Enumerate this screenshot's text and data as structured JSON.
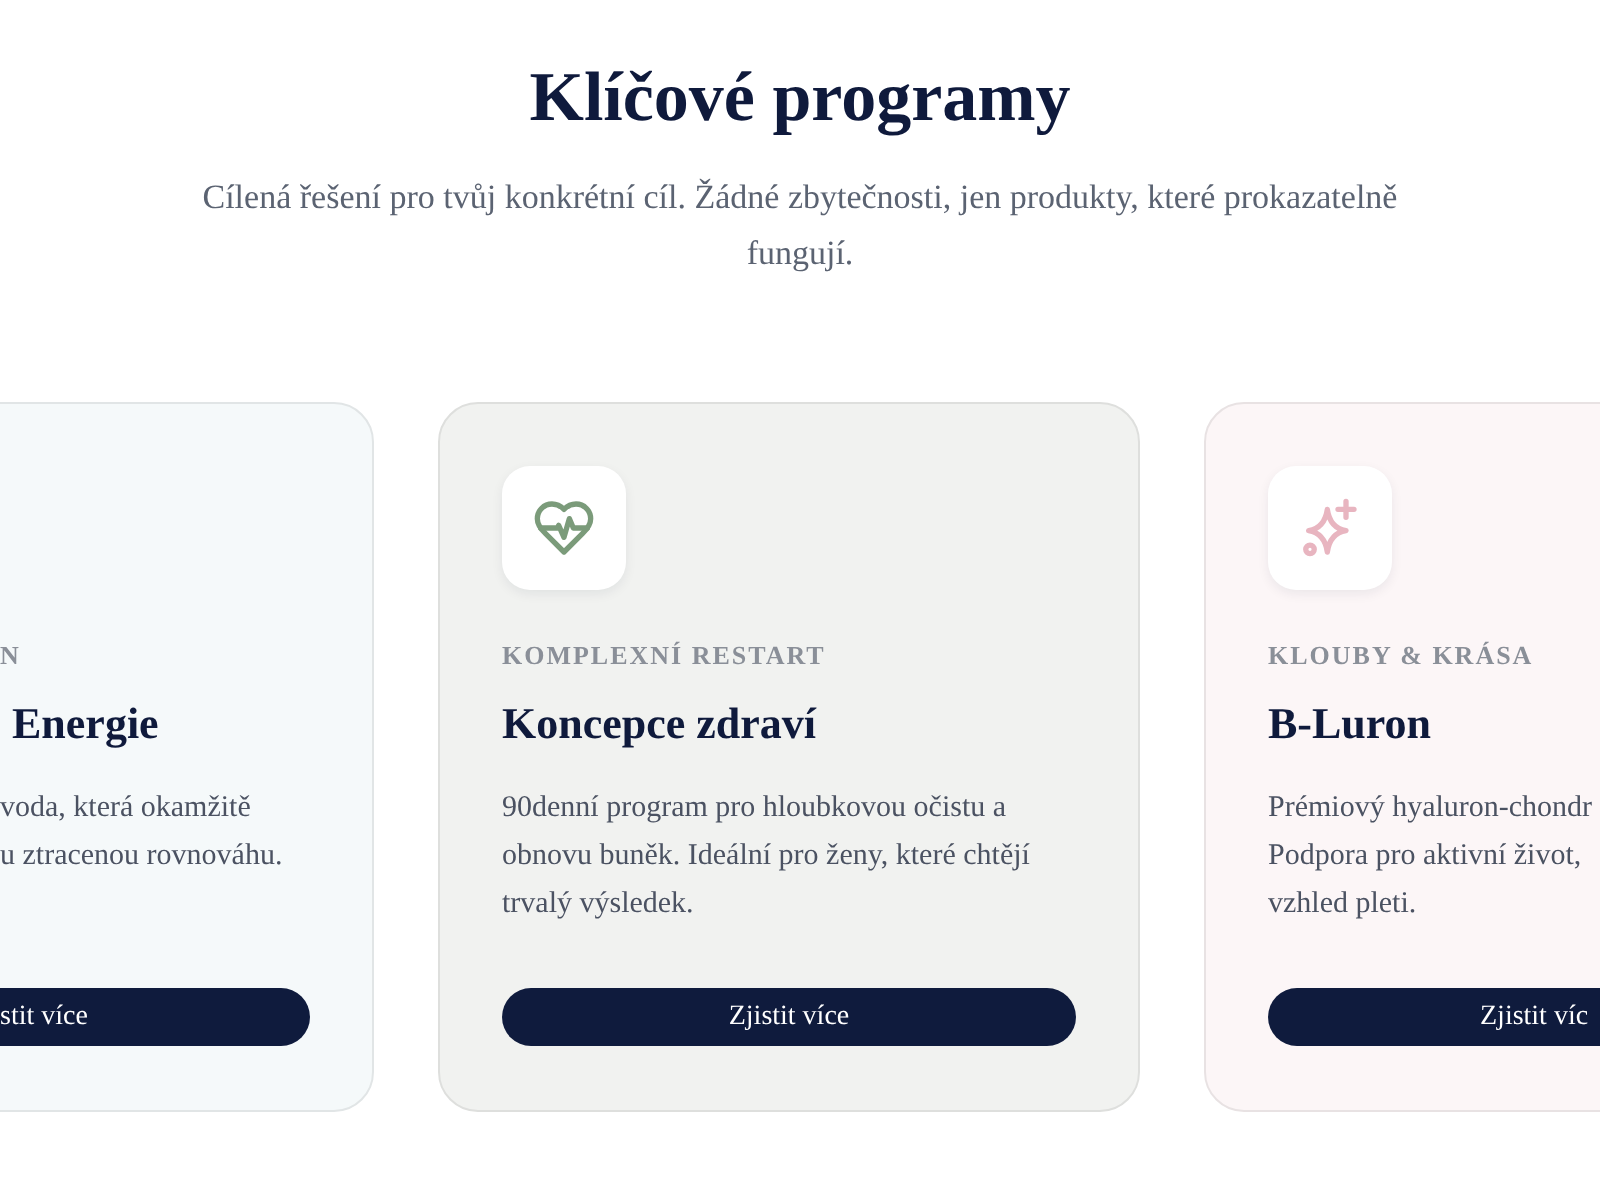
{
  "section": {
    "title": "Klíčové programy",
    "subtitle": "Cílená řešení pro tvůj konkrétní cíl. Žádné zbytečnosti, jen produkty, které prokazatelně fungují."
  },
  "cards": [
    {
      "color": "#f5f9fa",
      "category": "N",
      "title": "Energie",
      "description": "voda, která okamžitě\nu ztracenou rovnováhu.",
      "button": "stit více"
    },
    {
      "color": "#f1f2f0",
      "category": "KOMPLEXNÍ RESTART",
      "title": "Koncepce zdraví",
      "description": "90denní program pro hloubkovou očistu a obnovu buněk. Ideální pro ženy, které chtějí trvalý výsledek.",
      "button": "Zjistit více"
    },
    {
      "color": "#fcf6f7",
      "category": "KLOUBY & KRÁSA",
      "title": "B-Luron",
      "description": "Prémiový hyaluron-chondr\nPodpora pro aktivní život,\nvzhled pleti.",
      "button": "Zjistit víc"
    }
  ]
}
